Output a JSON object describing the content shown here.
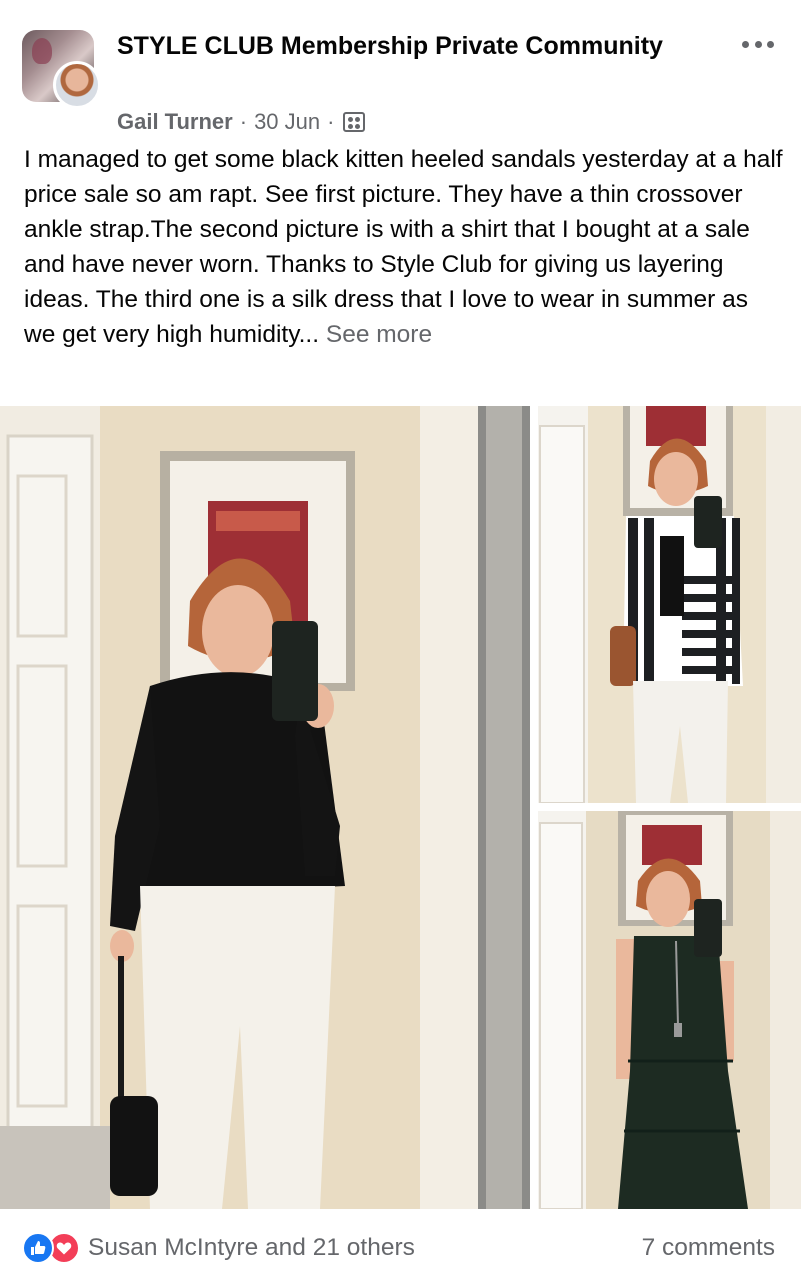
{
  "header": {
    "group_name": "STYLE CLUB Membership Private Community",
    "author": "Gail Turner",
    "date": "30 Jun",
    "separator": "·",
    "more_icon": "ellipsis-icon",
    "privacy_icon": "members-icon"
  },
  "post": {
    "text": "I managed to get some black kitten heeled sandals yesterday at a half price sale so am rapt. See first picture. They have a thin crossover ankle strap.The second picture is with a shirt that I bought at a sale and have never worn. Thanks to Style Club for giving us layering ideas. The third one is a silk dress that I love to wear in summer as we get very high humidity...",
    "see_more": "See more"
  },
  "photos": [
    {
      "icon": "photo-black-top-white-pants"
    },
    {
      "icon": "photo-striped-shirt"
    },
    {
      "icon": "photo-green-dress"
    }
  ],
  "footer": {
    "reactions_text": "Susan McIntyre and 21 others",
    "comments_text": "7 comments",
    "like_icon": "thumbs-up-icon",
    "love_icon": "heart-icon"
  },
  "colors": {
    "text": "#050505",
    "secondary": "#65676b",
    "like": "#1877f2",
    "love": "#f33e58"
  }
}
